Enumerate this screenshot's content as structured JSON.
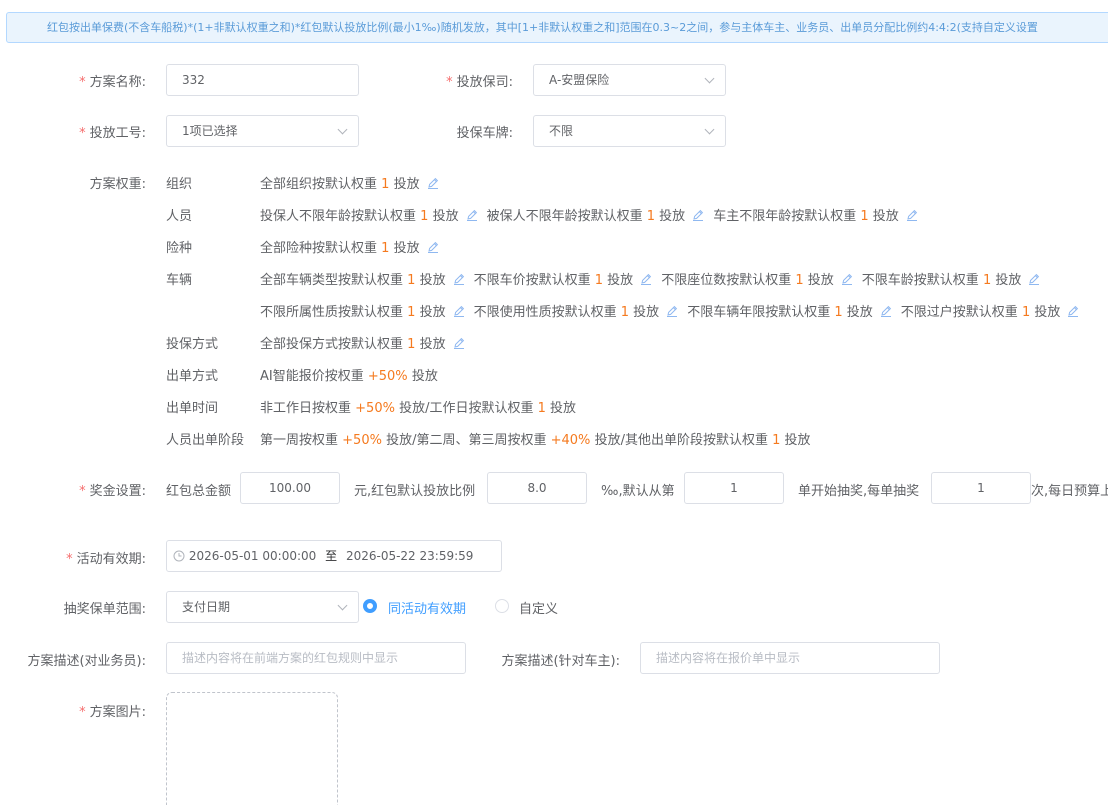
{
  "notice": "红包按出单保费(不含车船税)*(1+非默认权重之和)*红包默认投放比例(最小1‰)随机发放，其中[1+非默认权重之和]范围在0.3~2之间，参与主体车主、业务员、出单员分配比例约4:4:2(支持自定义设置",
  "form": {
    "plan_name": {
      "label": "方案名称:",
      "value": "332"
    },
    "insurer": {
      "label": "投放保司:",
      "value": "A-安盟保险"
    },
    "job_no": {
      "label": "投放工号:",
      "value": "1项已选择"
    },
    "plate": {
      "label": "投保车牌:",
      "value": "不限"
    },
    "weight_label": "方案权重:",
    "reward_label": "奖金设置:",
    "validity": {
      "label": "活动有效期:",
      "start": "2026-05-01 00:00:00",
      "sep": "至",
      "end": "2026-05-22 23:59:59"
    },
    "lottery": {
      "label": "抽奖保单范围:",
      "select": "支付日期",
      "radio_same": "同活动有效期",
      "radio_custom": "自定义"
    },
    "desc_agent": {
      "label": "方案描述(对业务员):",
      "placeholder": "描述内容将在前端方案的红包规则中显示"
    },
    "desc_owner": {
      "label": "方案描述(针对车主):",
      "placeholder": "描述内容将在报价单中显示"
    },
    "image": {
      "label": "方案图片:"
    }
  },
  "weights": {
    "org": {
      "cat": "组织",
      "items": [
        {
          "pre": "全部组织按默认权重",
          "num": "1",
          "post": "投放"
        }
      ]
    },
    "person": {
      "cat": "人员",
      "items": [
        {
          "pre": "投保人不限年龄按默认权重",
          "num": "1",
          "post": "投放"
        },
        {
          "pre": "被保人不限年龄按默认权重",
          "num": "1",
          "post": "投放"
        },
        {
          "pre": "车主不限年龄按默认权重",
          "num": "1",
          "post": "投放"
        }
      ]
    },
    "risk": {
      "cat": "险种",
      "items": [
        {
          "pre": "全部险种按默认权重",
          "num": "1",
          "post": "投放"
        }
      ]
    },
    "vehicle": {
      "cat": "车辆",
      "row1": [
        {
          "pre": "全部车辆类型按默认权重",
          "num": "1",
          "post": "投放"
        },
        {
          "pre": "不限车价按默认权重",
          "num": "1",
          "post": "投放"
        },
        {
          "pre": "不限座位数按默认权重",
          "num": "1",
          "post": "投放"
        },
        {
          "pre": "不限车龄按默认权重",
          "num": "1",
          "post": "投放"
        }
      ],
      "row2": [
        {
          "pre": "不限所属性质按默认权重",
          "num": "1",
          "post": "投放"
        },
        {
          "pre": "不限使用性质按默认权重",
          "num": "1",
          "post": "投放"
        },
        {
          "pre": "不限车辆年限按默认权重",
          "num": "1",
          "post": "投放"
        },
        {
          "pre": "不限过户按默认权重",
          "num": "1",
          "post": "投放"
        }
      ]
    },
    "method": {
      "cat": "投保方式",
      "items": [
        {
          "pre": "全部投保方式按默认权重",
          "num": "1",
          "post": "投放"
        }
      ]
    },
    "issue_method": {
      "cat": "出单方式",
      "pre": "AI智能报价按权重",
      "num": "+50%",
      "post": "投放"
    },
    "issue_time": {
      "cat": "出单时间",
      "p1": "非工作日按权重",
      "n1": "+50%",
      "p2": "投放/工作日按默认权重",
      "n2": "1",
      "p3": "投放"
    },
    "stage": {
      "cat": "人员出单阶段",
      "p1": "第一周按权重",
      "n1": "+50%",
      "p2": "投放/第二周、第三周按权重",
      "n2": "+40%",
      "p3": "投放/其他出单阶段按默认权重",
      "n3": "1",
      "p4": "投放"
    }
  },
  "reward": {
    "total_label": "红包总金额",
    "total": "100.00",
    "ratio_label": "元,红包默认投放比例",
    "ratio": "8.0",
    "start_label": "‰,默认从第",
    "start": "1",
    "each_label": "单开始抽奖,每单抽奖",
    "each": "1",
    "tail_label": "次,每日预算上"
  },
  "icons": {
    "edit": "pencil-icon",
    "clock": "clock-icon",
    "dropdown": "chevron-down-icon"
  },
  "colors": {
    "accent": "#409eff",
    "required": "#f56c6c",
    "number": "#f57a1f",
    "notice_bg": "#eaf4fd"
  }
}
